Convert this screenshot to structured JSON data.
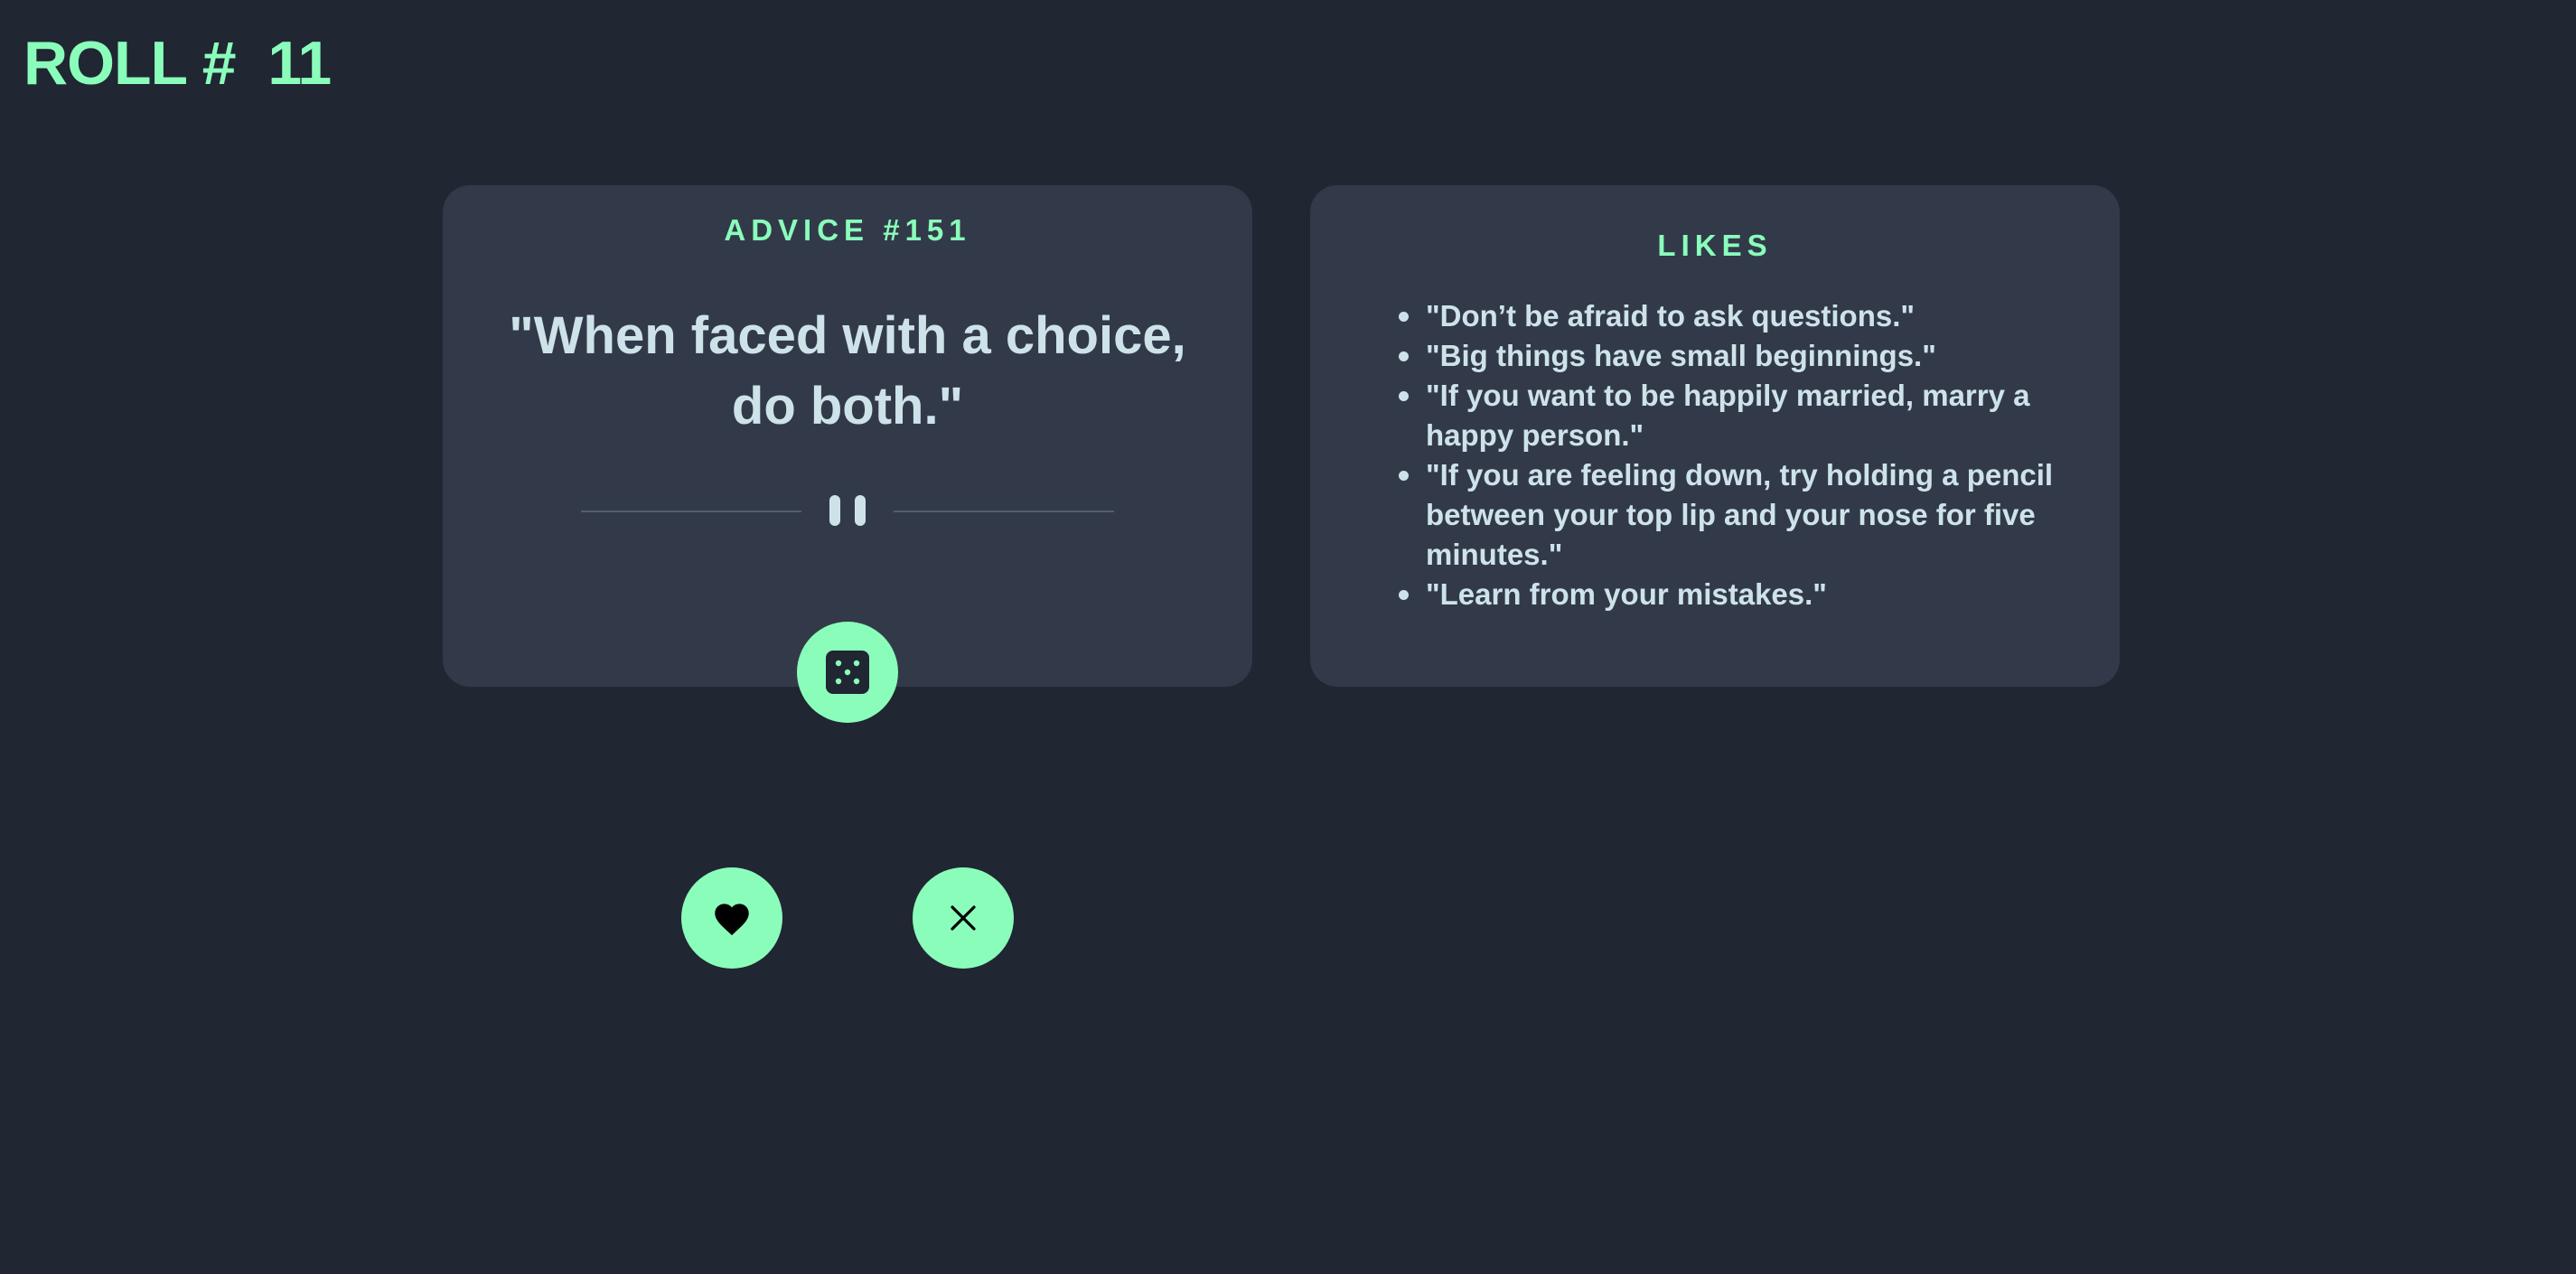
{
  "header": {
    "roll_title": "ROLL #  11"
  },
  "advice": {
    "label": "ADVICE #151",
    "quote": "\"When faced with a choice, do both.\""
  },
  "likes": {
    "label": "LIKES",
    "items": [
      "\"Don’t be afraid to ask questions.\"",
      "\"Big things have small beginnings.\"",
      "\"If you want to be happily married, marry a happy person.\"",
      "\"If you are feeling down, try holding a pencil between your top lip and your nose for five minutes.\"",
      "\"Learn from your mistakes.\""
    ]
  },
  "icons": {
    "divider": "pause-icon",
    "roll": "dice-icon",
    "like": "heart-icon",
    "dismiss": "close-icon"
  },
  "colors": {
    "background": "#202632",
    "card": "#323a49",
    "accent": "#8afdbb",
    "text": "#cee3e9",
    "divider": "#4f5d74"
  }
}
